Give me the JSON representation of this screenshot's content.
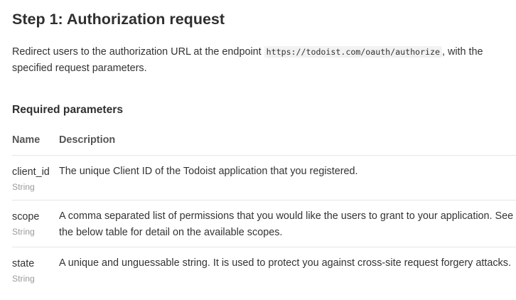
{
  "heading": "Step 1: Authorization request",
  "intro": {
    "before": "Redirect users to the authorization URL at the endpoint ",
    "endpoint": "https://todoist.com/oauth/authorize",
    "after": ", with the specified request parameters."
  },
  "subheading": "Required parameters",
  "table": {
    "columns": [
      "Name",
      "Description"
    ],
    "rows": [
      {
        "name": "client_id",
        "type": "String",
        "description": "The unique Client ID of the Todoist application that you registered."
      },
      {
        "name": "scope",
        "type": "String",
        "description": "A comma separated list of permissions that you would like the users to grant to your application. See the below table for detail on the available scopes."
      },
      {
        "name": "state",
        "type": "String",
        "description": "A unique and unguessable string. It is used to protect you against cross-site request forgery attacks."
      }
    ]
  }
}
